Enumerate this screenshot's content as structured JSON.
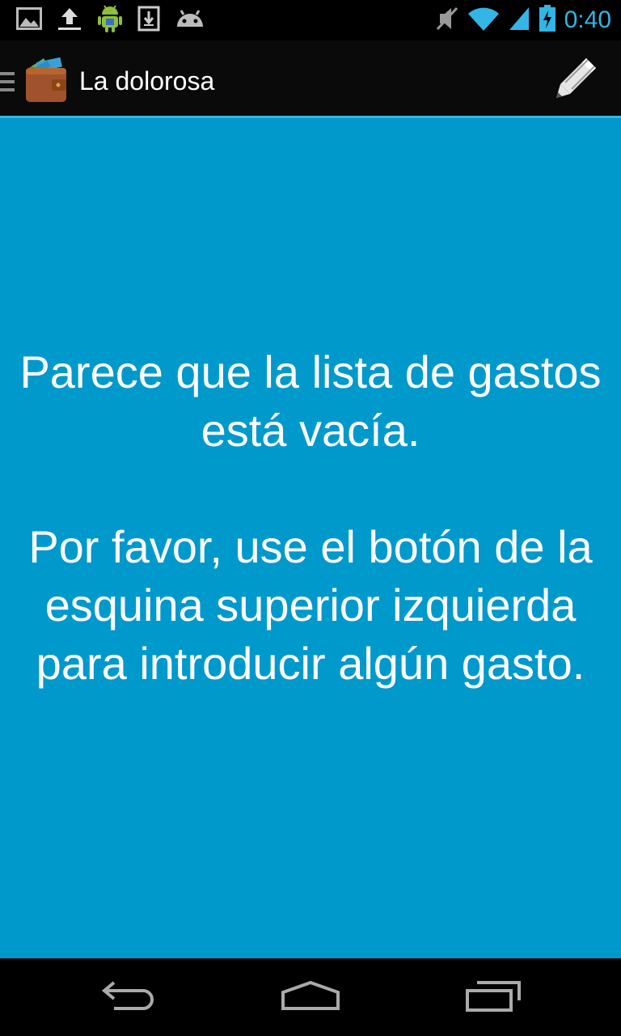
{
  "status_bar": {
    "time": "0:40",
    "left_icons": [
      "image-icon",
      "upload-icon",
      "android-icon",
      "download-icon",
      "android-head-icon"
    ],
    "right_icons": [
      "mute-icon",
      "wifi-icon",
      "signal-icon",
      "battery-charging-icon"
    ]
  },
  "action_bar": {
    "title": "La dolorosa",
    "accent_color": "#33b5e5"
  },
  "content": {
    "background_color": "#0099cc",
    "message": "Parece que la lista de gastos está vacía.\n\nPor favor, use el botón de la esquina superior izquierda para introducir algún gasto."
  },
  "nav_bar": {
    "buttons": [
      "back-icon",
      "home-icon",
      "recents-icon"
    ]
  }
}
